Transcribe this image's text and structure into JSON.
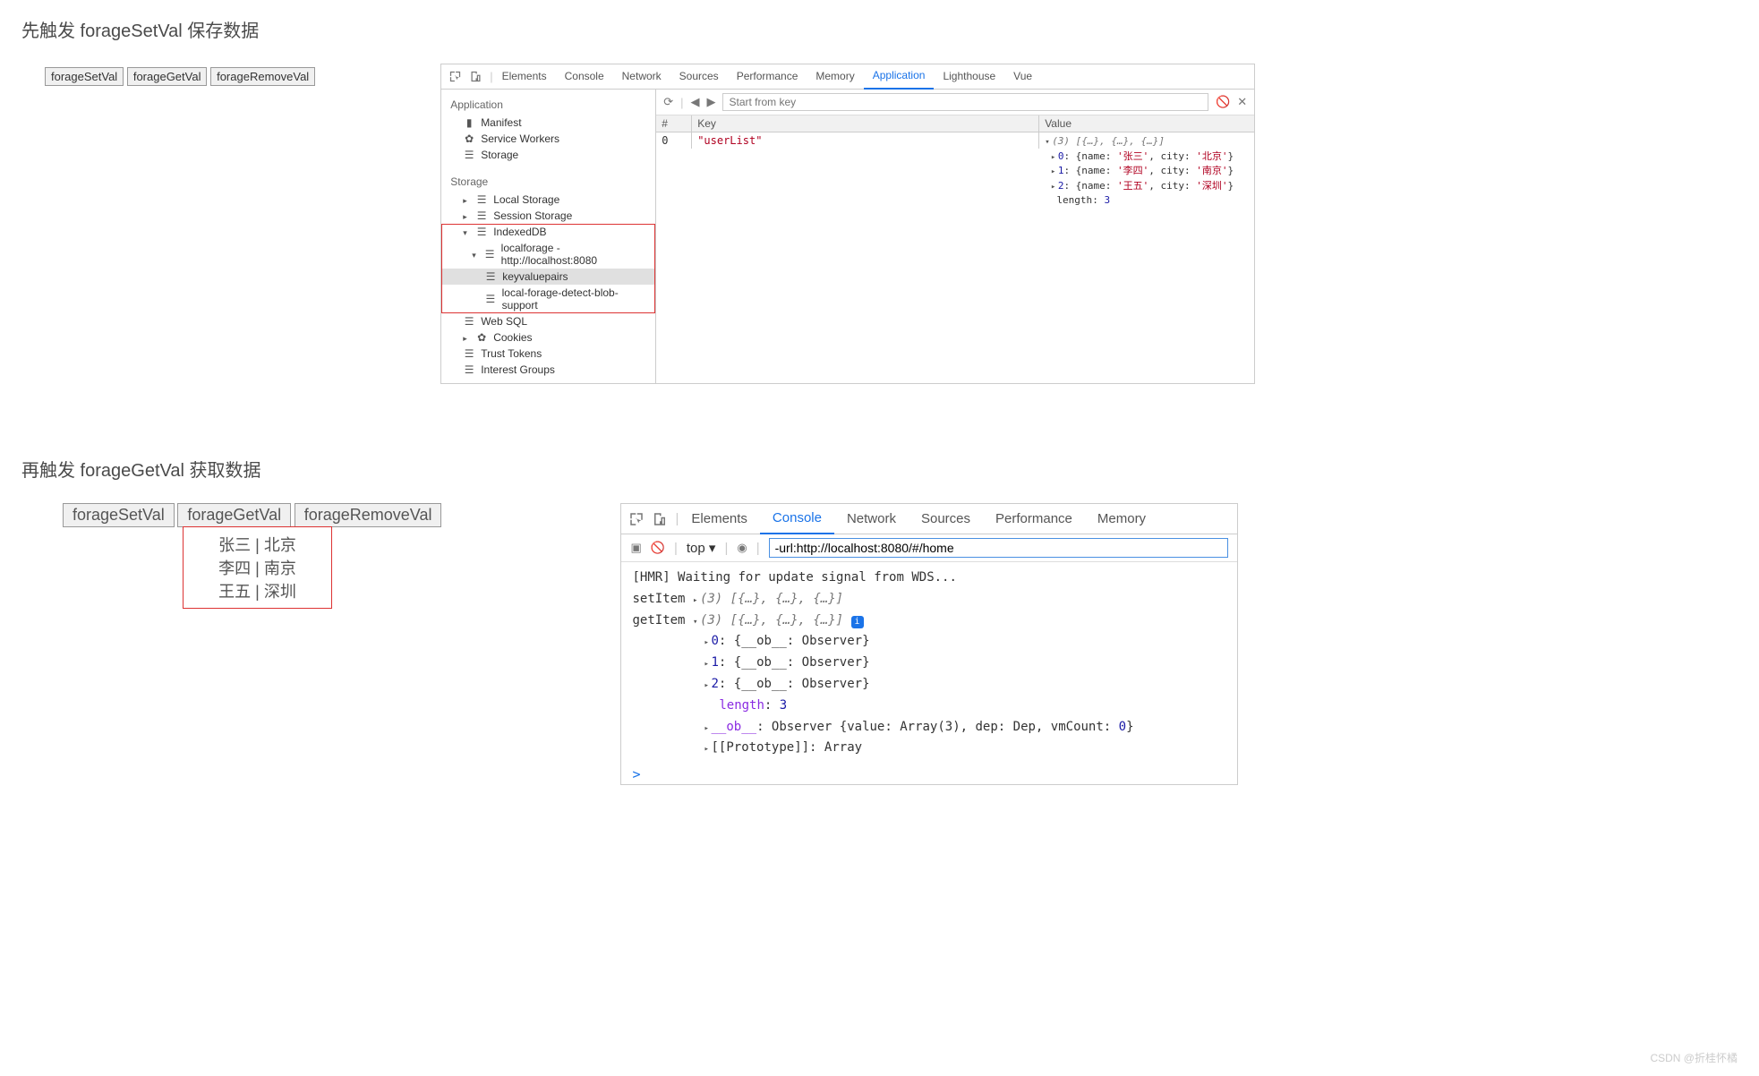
{
  "captions": {
    "first": "先触发 forageSetVal 保存数据",
    "second": "再触发 forageGetVal 获取数据"
  },
  "buttons": {
    "set": "forageSetVal",
    "get": "forageGetVal",
    "remove": "forageRemoveVal"
  },
  "devtools": {
    "tabs": [
      "Elements",
      "Console",
      "Network",
      "Sources",
      "Performance",
      "Memory",
      "Application",
      "Lighthouse",
      "Vue"
    ],
    "activeTab": "Application",
    "side": {
      "app_h": "Application",
      "manifest": "Manifest",
      "sw": "Service Workers",
      "storage": "Storage",
      "storage_h": "Storage",
      "local": "Local Storage",
      "session": "Session Storage",
      "idb": "IndexedDB",
      "idb_db": "localforage - http://localhost:8080",
      "idb_t1": "keyvaluepairs",
      "idb_t2": "local-forage-detect-blob-support",
      "websql": "Web SQL",
      "cookies": "Cookies",
      "trust": "Trust Tokens",
      "interest": "Interest Groups"
    },
    "filter": {
      "placeholder": "Start from key"
    },
    "table": {
      "cols": {
        "n": "#",
        "k": "Key",
        "v": "Value"
      },
      "row": {
        "n": "0",
        "k": "\"userList\""
      },
      "value_preview": {
        "head": "(3) [{…}, {…}, {…}]",
        "items": [
          {
            "idx": "0",
            "name": "'张三'",
            "city": "'北京'"
          },
          {
            "idx": "1",
            "name": "'李四'",
            "city": "'南京'"
          },
          {
            "idx": "2",
            "name": "'王五'",
            "city": "'深圳'"
          }
        ],
        "length_label": "length",
        "length_val": "3"
      }
    }
  },
  "resultList": [
    "张三 | 北京",
    "李四 | 南京",
    "王五 | 深圳"
  ],
  "devtools2": {
    "tabs": [
      "Elements",
      "Console",
      "Network",
      "Sources",
      "Performance",
      "Memory"
    ],
    "activeTab": "Console",
    "context": "top",
    "filter": "-url:http://localhost:8080/#/home",
    "lines": {
      "hmr": "[HMR] Waiting for update signal from WDS...",
      "setItem_label": "setItem",
      "preview3": "(3) [{…}, {…}, {…}]",
      "getItem_label": "getItem",
      "obs": [
        "0: {__ob__: Observer}",
        "1: {__ob__: Observer}",
        "2: {__ob__: Observer}"
      ],
      "length_label": "length",
      "length_val": "3",
      "ob_line": "__ob__: Observer {value: Array(3), dep: Dep, vmCount: 0}",
      "proto": "[[Prototype]]: Array"
    }
  },
  "watermark": "CSDN @折桂怀橘"
}
